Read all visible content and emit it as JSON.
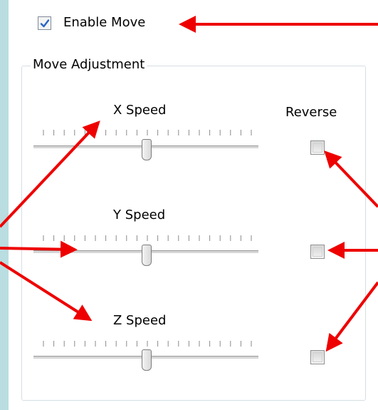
{
  "enable_move": {
    "label": "Enable Move",
    "checked": true
  },
  "group": {
    "title": "Move Adjustment",
    "reverse_header": "Reverse",
    "sliders": [
      {
        "label": "X Speed",
        "value": 0.5,
        "reverse": false
      },
      {
        "label": "Y Speed",
        "value": 0.5,
        "reverse": false
      },
      {
        "label": "Z Speed",
        "value": 0.5,
        "reverse": false
      }
    ]
  },
  "colors": {
    "background": "#b9dde0",
    "arrow": "#ee0000",
    "check": "#2a63c7"
  }
}
